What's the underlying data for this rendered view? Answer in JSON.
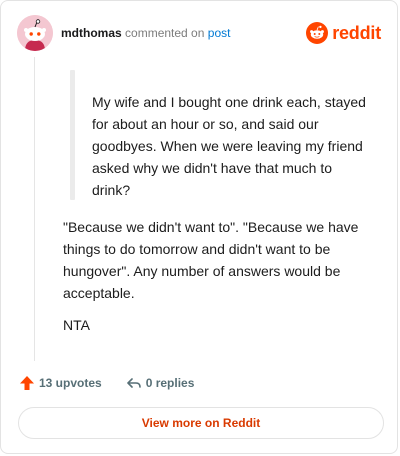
{
  "header": {
    "username": "mdthomas",
    "action_text": "commented on",
    "post_link": "post",
    "brand_name": "reddit"
  },
  "comment": {
    "quote": "My wife and I bought one drink each, stayed for about an hour or so, and said our goodbyes. When we were leaving my friend asked why we didn't have that much to drink?",
    "paragraphs": [
      "\"Because we didn't want to\". \"Because we have things to do tomorrow and didn't want to be hungover\". Any number of answers would be acceptable.",
      "NTA"
    ]
  },
  "stats": {
    "upvotes": "13 upvotes",
    "replies": "0 replies"
  },
  "view_button": "View more on Reddit",
  "colors": {
    "brand": "#ff4500",
    "link": "#0079d3",
    "upvote": "#ff4500",
    "button_text": "#d93a00",
    "avatar_bg": "#f4c7d1"
  },
  "icons": {
    "avatar": "snoo-avatar-icon",
    "brand": "reddit-logo-icon",
    "upvote": "upvote-arrow-icon",
    "reply": "reply-arrow-icon"
  }
}
